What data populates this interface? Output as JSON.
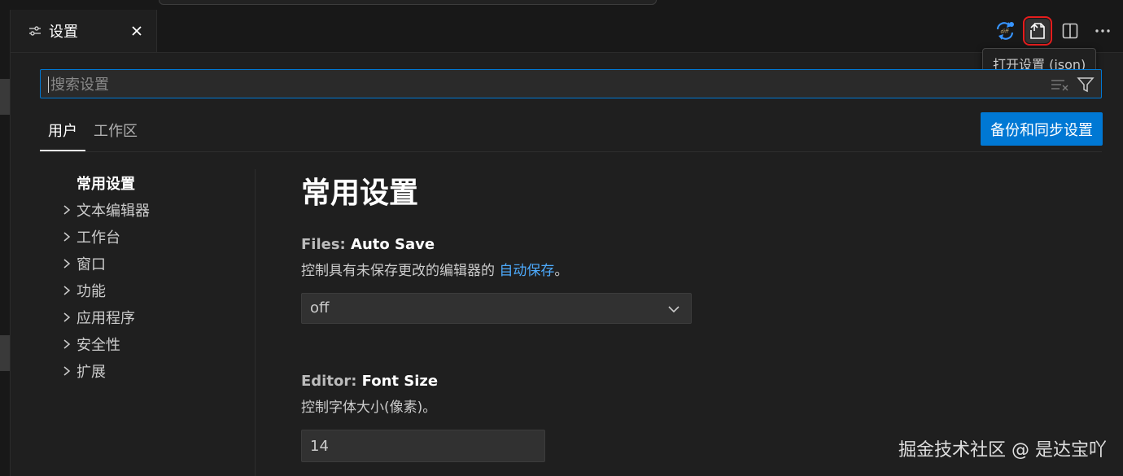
{
  "tab": {
    "title": "设置",
    "icon": "settings-sliders-icon"
  },
  "actions": [
    {
      "name": "diff-sync-icon"
    },
    {
      "name": "open-json-icon",
      "active": true
    },
    {
      "name": "split-editor-icon"
    },
    {
      "name": "more-actions-icon"
    }
  ],
  "tooltip": "打开设置 (json)",
  "search": {
    "placeholder": "搜索设置",
    "value": ""
  },
  "scope_tabs": [
    {
      "label": "用户",
      "active": true
    },
    {
      "label": "工作区",
      "active": false
    }
  ],
  "sync_button": "备份和同步设置",
  "toc": [
    {
      "label": "常用设置",
      "selected": true,
      "expandable": false
    },
    {
      "label": "文本编辑器",
      "expandable": true
    },
    {
      "label": "工作台",
      "expandable": true
    },
    {
      "label": "窗口",
      "expandable": true
    },
    {
      "label": "功能",
      "expandable": true
    },
    {
      "label": "应用程序",
      "expandable": true
    },
    {
      "label": "安全性",
      "expandable": true
    },
    {
      "label": "扩展",
      "expandable": true
    }
  ],
  "content": {
    "section_title": "常用设置",
    "auto_save": {
      "category": "Files: ",
      "name": "Auto Save",
      "desc_prefix": "控制具有未保存更改的编辑器的 ",
      "desc_link": "自动保存",
      "desc_suffix": "。",
      "value": "off"
    },
    "font_size": {
      "category": "Editor: ",
      "name": "Font Size",
      "desc": "控制字体大小(像素)。",
      "value": "14"
    }
  },
  "watermark": "掘金技术社区 @ 是达宝吖",
  "colors": {
    "accent": "#0078d4",
    "link": "#4daafc",
    "highlight_border": "#e51d1d",
    "background": "#1f1f1f"
  }
}
